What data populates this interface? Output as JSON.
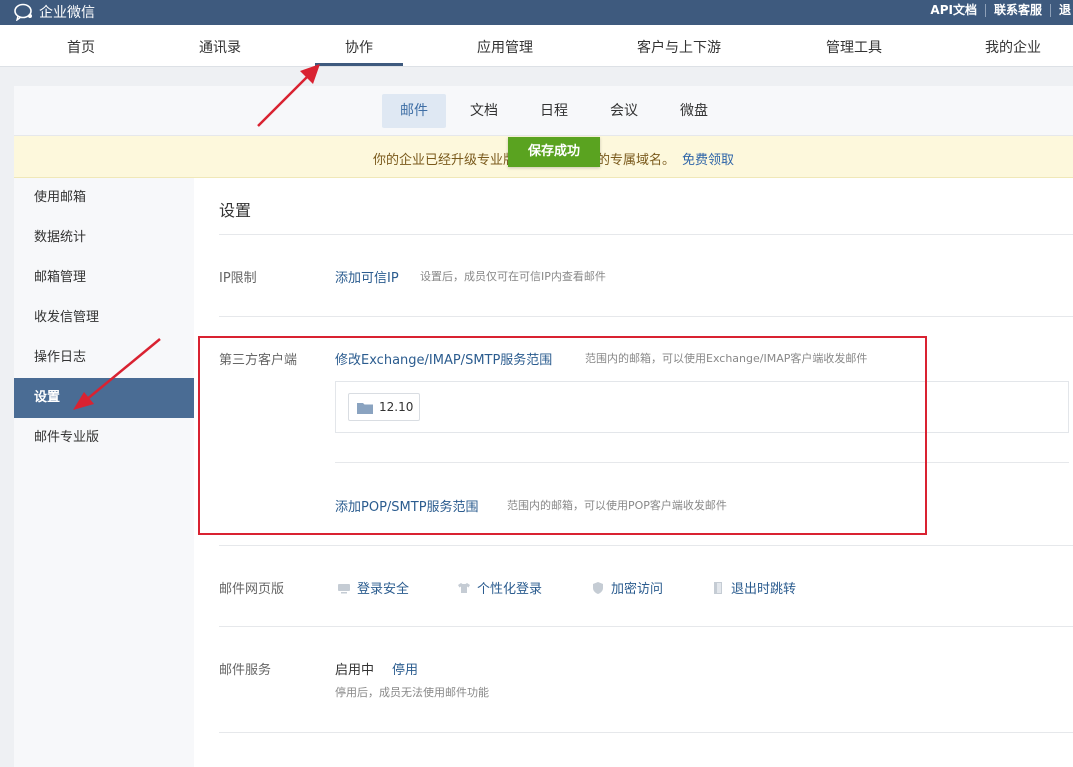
{
  "topbar": {
    "app_name": "企业微信",
    "links": [
      "API文档",
      "联系客服",
      "退"
    ]
  },
  "main_nav": {
    "items": [
      "首页",
      "通讯录",
      "协作",
      "应用管理",
      "客户与上下游",
      "管理工具",
      "我的企业"
    ],
    "active": "协作"
  },
  "sub_nav": {
    "tabs": [
      "邮件",
      "文档",
      "日程",
      "会议",
      "微盘"
    ],
    "active": "邮件"
  },
  "notice": {
    "text_before": "你的企业已经升级专业版",
    "text_after": "的专属域名。",
    "link": "免费领取"
  },
  "toast": {
    "text": "保存成功"
  },
  "sidebar": {
    "items": [
      "使用邮箱",
      "数据统计",
      "邮箱管理",
      "收发信管理",
      "操作日志",
      "设置",
      "邮件专业版"
    ],
    "active": "设置"
  },
  "settings": {
    "title": "设置",
    "ip": {
      "label": "IP限制",
      "link": "添加可信IP",
      "desc": "设置后，成员仅可在可信IP内查看邮件"
    },
    "third_party": {
      "label": "第三方客户端",
      "exchange_link": "修改Exchange/IMAP/SMTP服务范围",
      "exchange_desc": "范围内的邮箱，可以使用Exchange/IMAP客户端收发邮件",
      "folder_chip": "12.10",
      "pop_link": "添加POP/SMTP服务范围",
      "pop_desc": "范围内的邮箱，可以使用POP客户端收发邮件"
    },
    "web": {
      "label": "邮件网页版",
      "items": [
        "登录安全",
        "个性化登录",
        "加密访问",
        "退出时跳转"
      ]
    },
    "service": {
      "label": "邮件服务",
      "status": "启用中",
      "action": "停用",
      "desc": "停用后，成员无法使用邮件功能"
    }
  },
  "colors": {
    "topbar": "#3e5a7e",
    "active_sidebar": "#4a6c94",
    "toast": "#5aa320",
    "link": "#2b5c8f",
    "annotation_red": "#d92231"
  }
}
